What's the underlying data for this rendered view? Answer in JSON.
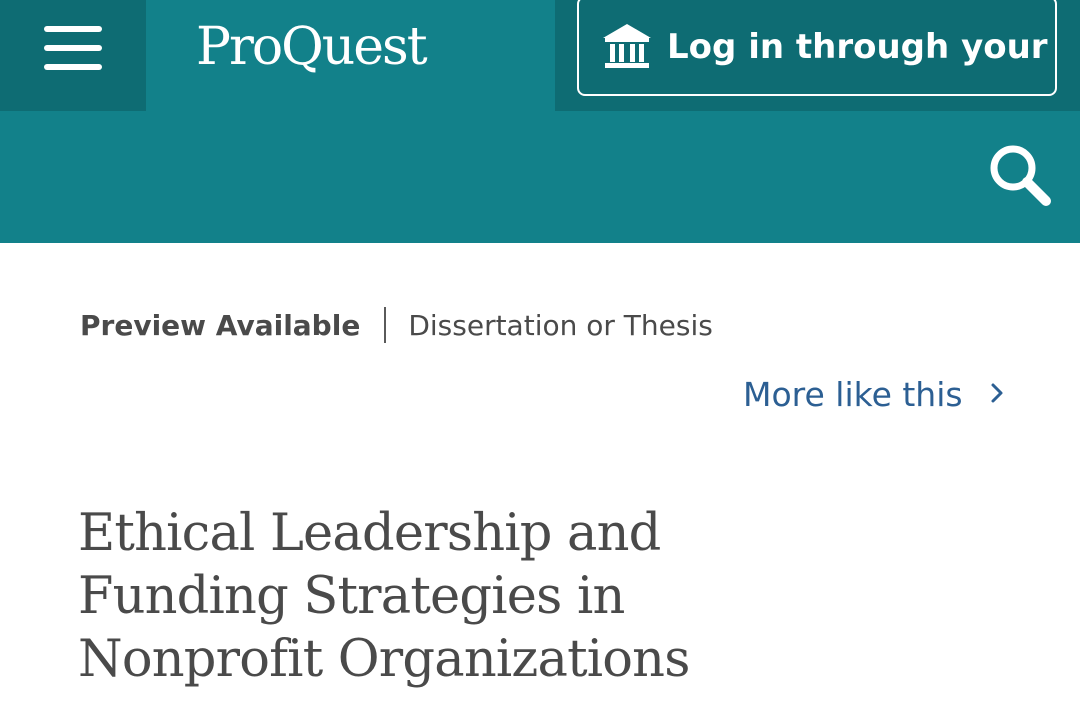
{
  "header": {
    "logo_text": "ProQuest",
    "login_label": "Log in through your library",
    "colors": {
      "primary_teal": "#12818a",
      "dark_teal": "#0e6c73"
    },
    "icons": {
      "menu": "hamburger-menu-icon",
      "login": "bank-building-icon",
      "search": "magnifier-search-icon"
    }
  },
  "document": {
    "preview_label": "Preview Available",
    "type_label": "Dissertation or Thesis",
    "more_like_this": "More like this",
    "title": "Ethical Leadership and Funding Strategies in Nonprofit Organizations",
    "colors": {
      "link_blue": "#2c5f93",
      "text_gray": "#4a4a4a"
    }
  }
}
